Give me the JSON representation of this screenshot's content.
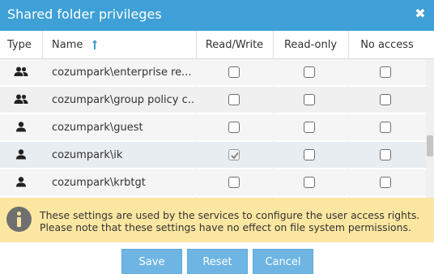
{
  "dialog": {
    "title": "Shared folder privileges",
    "close_glyph": "✖"
  },
  "table": {
    "columns": {
      "type": "Type",
      "name": "Name",
      "read_write": "Read/Write",
      "read_only": "Read-only",
      "no_access": "No access"
    },
    "sort": {
      "column": "name",
      "direction": "ascending",
      "icon": "sort-arrow-up-icon"
    },
    "rows": [
      {
        "type_icon": "group-icon",
        "name": "cozumpark\\enterprise re...",
        "read_write": false,
        "read_only": false,
        "no_access": false
      },
      {
        "type_icon": "group-icon",
        "name": "cozumpark\\group policy c...",
        "read_write": false,
        "read_only": false,
        "no_access": false
      },
      {
        "type_icon": "user-icon",
        "name": "cozumpark\\guest",
        "read_write": false,
        "read_only": false,
        "no_access": false
      },
      {
        "type_icon": "user-icon",
        "name": "cozumpark\\ik",
        "read_write": true,
        "read_only": false,
        "no_access": false
      },
      {
        "type_icon": "user-icon",
        "name": "cozumpark\\krbtgt",
        "read_write": false,
        "read_only": false,
        "no_access": false
      }
    ]
  },
  "info": {
    "icon": "info-icon",
    "line1": "These settings are used by the services to configure the user access rights.",
    "line2": "Please note that these settings have no effect on file system permissions."
  },
  "buttons": {
    "save": "Save",
    "reset": "Reset",
    "cancel": "Cancel"
  },
  "colors": {
    "titlebar": "#3ea0d6",
    "button": "#6eb5e3",
    "info_background": "#fbe7a1"
  }
}
